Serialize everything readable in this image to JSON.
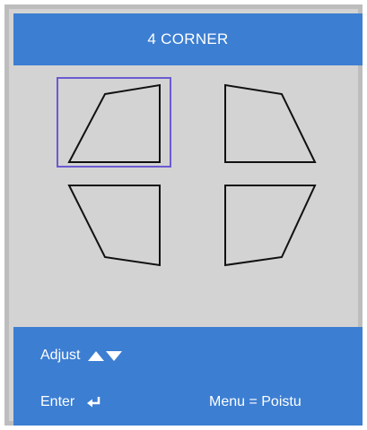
{
  "title": "4 CORNER",
  "selected_corner": "top-left",
  "icons": {
    "adjust": "up-down-triangles-icon",
    "enter": "enter-arrow-icon"
  },
  "footer": {
    "adjust_label": "Adjust",
    "enter_label": "Enter",
    "menu_label": "Menu = Poistu"
  },
  "colors": {
    "accent": "#3c7ed2",
    "panel": "#d3d3d3",
    "border": "#bdbdbd",
    "selection": "#6a5ad1"
  }
}
